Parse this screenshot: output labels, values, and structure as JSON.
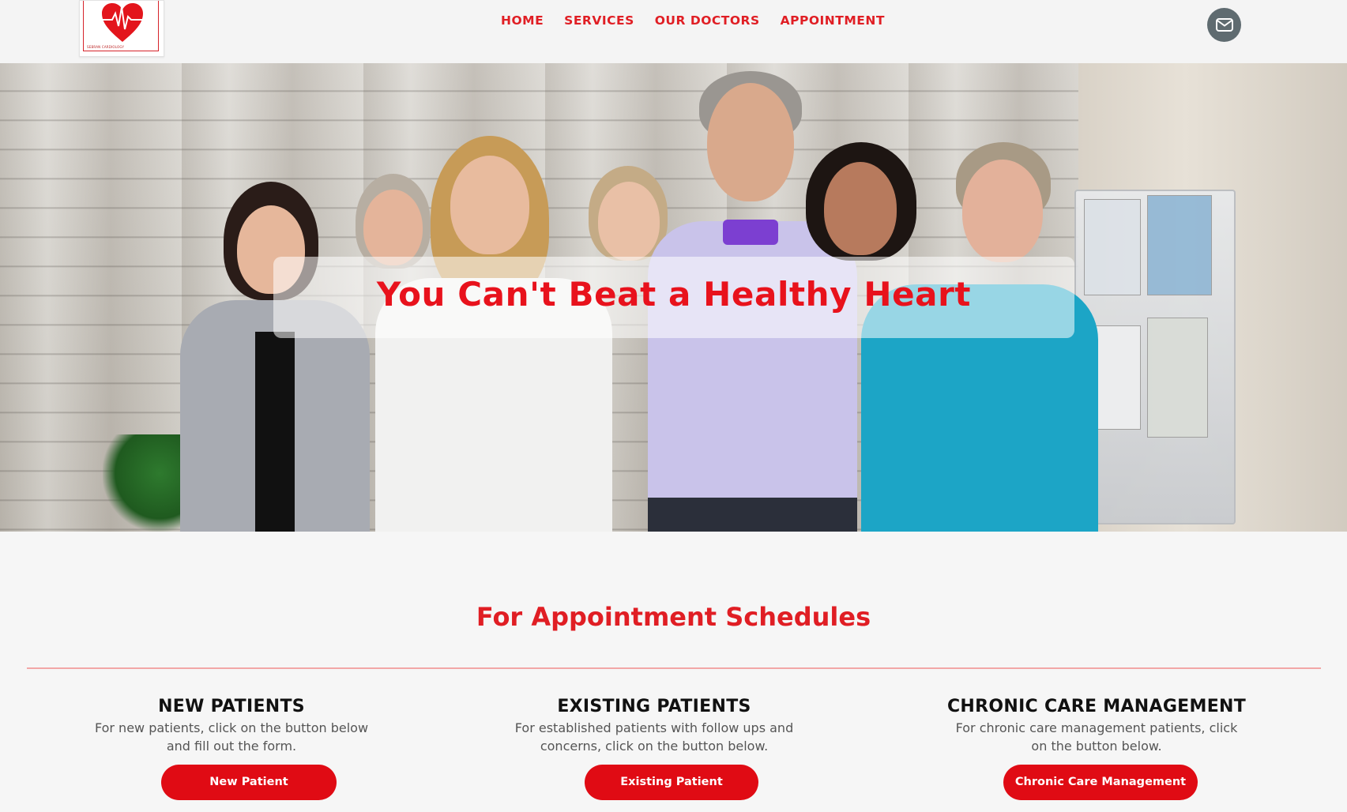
{
  "brand": {
    "logo_caption": "SEBRAN CARDIOLOGY"
  },
  "nav": {
    "items": [
      "HOME",
      "SERVICES",
      "OUR DOCTORS",
      "APPOINTMENT"
    ]
  },
  "hero": {
    "title": "You Can't Beat a Healthy Heart"
  },
  "appointments": {
    "title": "For Appointment Schedules",
    "columns": [
      {
        "title": "NEW PATIENTS",
        "description": "For new patients, click on the button below and fill out the form.",
        "button": "New Patient"
      },
      {
        "title": "EXISTING PATIENTS",
        "description": "For established patients with follow ups and concerns, click on the button below.",
        "button": "Existing Patient"
      },
      {
        "title": "CHRONIC CARE MANAGEMENT",
        "description": "For chronic care management patients, click on the button below.",
        "button": "Chronic Care Management"
      }
    ]
  },
  "colors": {
    "accent": "#e01e24",
    "button": "#e00b14",
    "mail_button": "#5f6b70",
    "divider": "#f2a7a7"
  },
  "icons": {
    "logo": "heart-ekg-icon",
    "contact": "envelope-icon"
  }
}
